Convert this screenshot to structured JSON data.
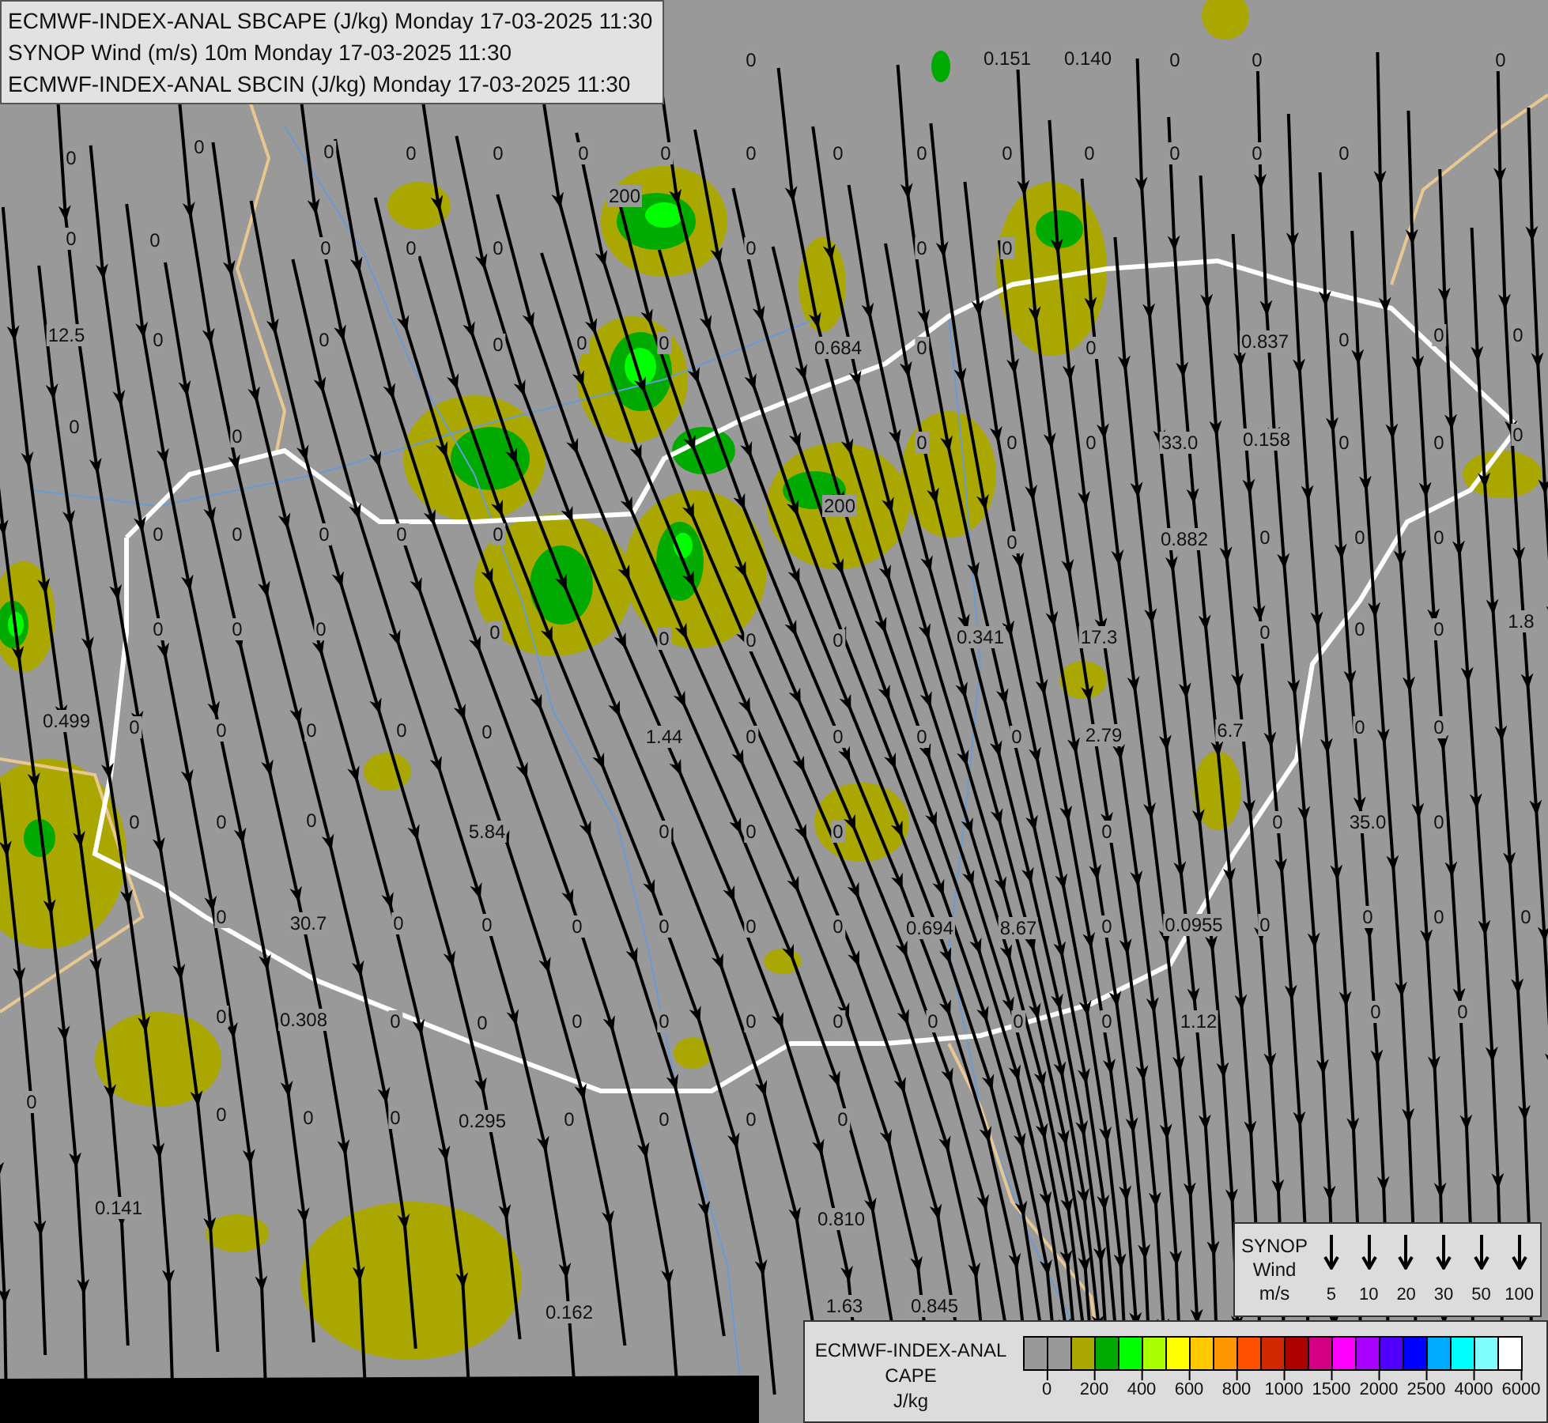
{
  "title_box": {
    "lines": [
      "ECMWF-INDEX-ANAL SBCAPE (J/kg) Monday 17-03-2025 11:30",
      "SYNOP Wind (m/s) 10m Monday 17-03-2025 11:30",
      "ECMWF-INDEX-ANAL SBCIN (J/kg) Monday 17-03-2025 11:30"
    ]
  },
  "map_labels": [
    "0.151",
    "0.140",
    "12.5",
    "0.684",
    "0.837",
    "33.0",
    "0.158",
    "0.882",
    "0.341",
    "17.3",
    "1.8",
    "0.499",
    "1.44",
    "2.79",
    "6.7",
    "5.84",
    "35.0",
    "30.7",
    "0.694",
    "8.67",
    "0.0955",
    "0.308",
    "1.12",
    "0.295",
    "0.141",
    "0.810",
    "0.162",
    "1.63",
    "0.845",
    "200",
    "200",
    "0",
    "0",
    "0",
    "0",
    "0",
    "0",
    "0",
    "0",
    "0",
    "0",
    "0",
    "0",
    "0",
    "0",
    "0",
    "0",
    "0",
    "0",
    "0",
    "0",
    "0",
    "0",
    "0",
    "0",
    "0",
    "0",
    "0",
    "0",
    "0",
    "0",
    "0",
    "0",
    "0",
    "0",
    "0",
    "0",
    "0",
    "0",
    "0",
    "0",
    "0",
    "0",
    "0",
    "0",
    "0",
    "0",
    "0",
    "0",
    "0",
    "0",
    "0",
    "0",
    "0",
    "0",
    "0",
    "0",
    "0",
    "0",
    "0",
    "0",
    "0",
    "0",
    "0",
    "0",
    "0",
    "0",
    "0",
    "0",
    "0",
    "0",
    "0",
    "0",
    "0",
    "0",
    "0",
    "0",
    "0",
    "0",
    "0",
    "0",
    "0",
    "0",
    "0",
    "0",
    "0",
    "0",
    "0",
    "0",
    "0",
    "0",
    "0",
    "0",
    "0",
    "0",
    "0",
    "0",
    "0",
    "0",
    "0",
    "0",
    "0",
    "0",
    "0",
    "0",
    "0",
    "0",
    "0",
    "0",
    "0",
    "0",
    "0",
    "0",
    "0",
    "0",
    "0",
    "0"
  ],
  "wind_legend": {
    "title_lines": [
      "SYNOP",
      "Wind",
      "m/s"
    ],
    "speeds": [
      "5",
      "10",
      "20",
      "30",
      "50",
      "100"
    ]
  },
  "cape_legend": {
    "title_lines": [
      "ECMWF-INDEX-ANAL",
      "CAPE",
      "J/kg"
    ],
    "swatches": [
      {
        "color": "#999999"
      },
      {
        "color": "#999999"
      },
      {
        "color": "#aaa800"
      },
      {
        "color": "#00aa00"
      },
      {
        "color": "#00ff00"
      },
      {
        "color": "#aaff00"
      },
      {
        "color": "#ffff00"
      },
      {
        "color": "#ffc800"
      },
      {
        "color": "#ff9600"
      },
      {
        "color": "#ff5000"
      },
      {
        "color": "#d22800"
      },
      {
        "color": "#aa0000"
      },
      {
        "color": "#d20082"
      },
      {
        "color": "#ff00ff"
      },
      {
        "color": "#aa00ff"
      },
      {
        "color": "#5000ff"
      },
      {
        "color": "#0000ff"
      },
      {
        "color": "#00aaff"
      },
      {
        "color": "#00ffff"
      },
      {
        "color": "#80ffff"
      },
      {
        "color": "#ffffff"
      }
    ],
    "ticks": [
      "0",
      "200",
      "400",
      "600",
      "800",
      "1000",
      "1500",
      "2000",
      "2500",
      "4000",
      "6000"
    ]
  }
}
